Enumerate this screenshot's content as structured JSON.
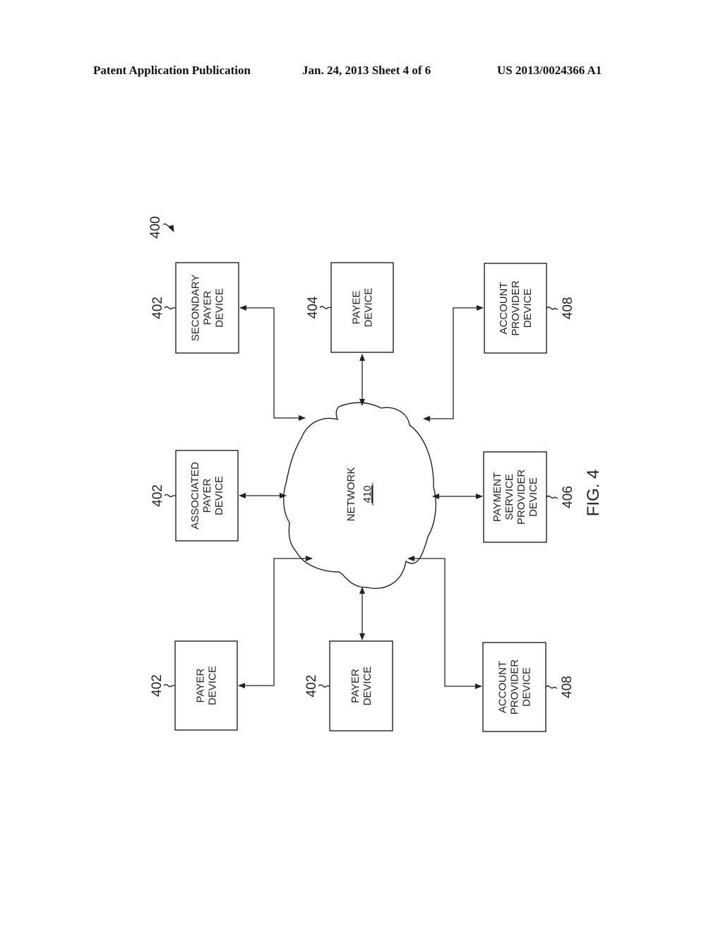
{
  "header": {
    "publication": "Patent Application Publication",
    "date_sheet": "Jan. 24, 2013  Sheet 4 of 6",
    "patent_number": "US 2013/0024366 A1"
  },
  "figure": {
    "label": "FIG. 4",
    "system_ref": "400",
    "network": {
      "label": "NETWORK",
      "ref": "410"
    },
    "nodes": [
      {
        "id": "secondary-payer",
        "lines": [
          "SECONDARY",
          "PAYER",
          "DEVICE"
        ],
        "ref": "402"
      },
      {
        "id": "payee",
        "lines": [
          "PAYEE",
          "DEVICE"
        ],
        "ref": "404"
      },
      {
        "id": "account-provider-top",
        "lines": [
          "ACCOUNT",
          "PROVIDER",
          "DEVICE"
        ],
        "ref": "408"
      },
      {
        "id": "associated-payer",
        "lines": [
          "ASSOCIATED",
          "PAYER",
          "DEVICE"
        ],
        "ref": "402"
      },
      {
        "id": "payment-service-provider",
        "lines": [
          "PAYMENT",
          "SERVICE",
          "PROVIDER",
          "DEVICE"
        ],
        "ref": "406"
      },
      {
        "id": "payer-1",
        "lines": [
          "PAYER",
          "DEVICE"
        ],
        "ref": "402"
      },
      {
        "id": "payer-2",
        "lines": [
          "PAYER",
          "DEVICE"
        ],
        "ref": "402"
      },
      {
        "id": "account-provider-bottom",
        "lines": [
          "ACCOUNT",
          "PROVIDER",
          "DEVICE"
        ],
        "ref": "408"
      }
    ],
    "connections": [
      "secondary-payer<->network",
      "payee<->network",
      "account-provider-top<->network",
      "associated-payer<->network",
      "payment-service-provider<->network",
      "payer-1<->network",
      "payer-2<->network",
      "account-provider-bottom<->network"
    ]
  }
}
